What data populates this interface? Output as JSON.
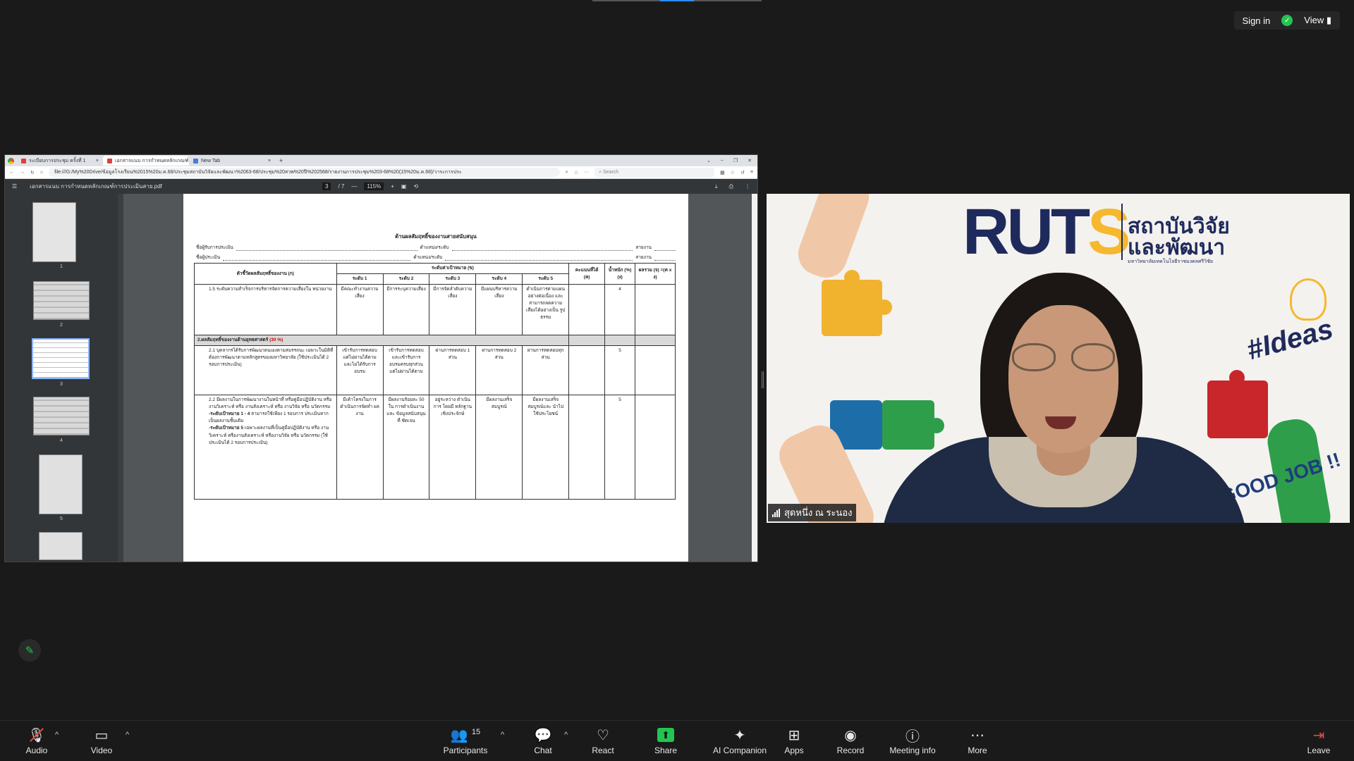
{
  "topbar": {
    "sign_in": "Sign in",
    "view": "View"
  },
  "browser": {
    "tabs": [
      {
        "label": "ระเบียบการประชุม ครั้งที่ 1",
        "active": false
      },
      {
        "label": "เอกสารแนบ การกำหนดหลักเกณฑ์",
        "active": true
      },
      {
        "label": "New Tab",
        "active": false
      }
    ],
    "url": "file:///G:/My%20Drive/ข้อมูลโรงเรียน%2015%20ม.ค.68/ประชุมสถาบันวิจัยและพัฒนา%2063-68/ประชุม%20สวพ%20ปี%202568/รายงานการประชุม%203-68%20(15%20ม.ค.68)/วาระการประ",
    "search_placeholder": "Search"
  },
  "pdf": {
    "title": "เอกสารแนบ การกำหนดหลักเกณฑ์การประเมินสาย.pdf",
    "page_current": "3",
    "page_total": "/ 7",
    "zoom": "115%",
    "thumb_numbers": [
      "1",
      "2",
      "3",
      "4",
      "5"
    ]
  },
  "document": {
    "heading": "ด้านผลสัมฤทธิ์ของงานสายสนับสนุน",
    "line1": {
      "label": "ชื่อผู้รับการประเมิน",
      "mid": "ตำแหน่ง/ระดับ",
      "end": "สายงาน"
    },
    "line2": {
      "label": "ชื่อผู้ประเมิน",
      "mid": "ตำแหน่ง/ระดับ",
      "end": "สายงาน"
    },
    "headers": {
      "indicator": "ตัวชี้วัดผลสัมฤทธิ์ของงาน (ก)",
      "target": "ระดับค่าเป้าหมาย (ข)",
      "levels": [
        "ระดับ 1",
        "ระดับ 2",
        "ระดับ 3",
        "ระดับ 4",
        "ระดับ 5"
      ],
      "score": "คะแนนที่ได้ (ค)",
      "weight": "น้ำหนัก (%) (ง)",
      "total": "ผลรวม (จ) =(ค x ง)"
    },
    "rows": [
      {
        "indicator": "1.5 ระดับความสำเร็จการบริหารจัดการความเสี่ยงใน หน่วยงาน",
        "levels": [
          "มีคณะทำงานความ เสี่ยง",
          "มีการระบุความเสี่ยง",
          "มีการจัดลำดับความ เสี่ยง",
          "มีแผนบริหารความ เสี่ยง",
          "ดำเนินการตามแผน อย่างต่อเนื่อง และ สามารถลดความ เสี่ยงได้อย่างเป็น รูปธรรม"
        ],
        "weight": "4"
      }
    ],
    "section2": {
      "label": "2.ผลสัมฤทธิ์ของงานด้านยุทธศาสตร์",
      "pct": "(30 %)"
    },
    "rows2": [
      {
        "indicator": "2.1 บุคลากรได้รับการพัฒนาตนเองตามสมรรถนะ เฉพาะในมิติที่ต้องการพัฒนาตามหลักสูตรของมหาวิทยาลัย (ใช้ประเมินได้ 2 รอบการประเมิน)",
        "levels": [
          "เข้ารับการทดสอบ แต่ไม่ผ่านได้ตาม และไม่ได้รับการ อบรม",
          "เข้ารับการทดสอบ และเข้ารับการ อบรมครบทุกส่วน แต่ไม่ผ่านได้ตาม",
          "ผ่านการทดสอบ 1 ส่วน",
          "ผ่านการทดสอบ 2 ส่วน",
          "ผ่านการทดสอบทุก ส่วน"
        ],
        "weight": "5"
      },
      {
        "indicator": "2.2 มีผลงานในการพัฒนางานในหน้าที่ หรือคู่มือปฏิบัติงาน หรืองานวิเคราะห์ หรือ งานสังเคราะห์ หรือ งานวิจัย หรือ นวัตกรรม",
        "note1_bold": "-ระดับเป้าหมาย 1 - 4",
        "note1": "สามารถใช้เพียง 1 รอบการ ประเมินหากเป็นผลงานชิ้นเดิม",
        "note2_bold": "-ระดับเป้าหมาย 5",
        "note2": "เฉพาะผลงานที่เป็นคู่มือปฏิบัติงาน หรือ งานวิเคราะห์ หรืองานสังเคราะห์ หรืองานวิจัย หรือ นวัตกรรม (ใช้ประเมินได้ 2 รอบการประเมิน)",
        "levels": [
          "มีเค้าโครงในการ ดำเนินการจัดทำ ผลงาน",
          "มีผลงานร้อยละ 50 ใน การดำเนินงาน และ ข้อมูลสนับสนุนที่ ชัดเจน",
          "อยู่ระหว่าง ดำเนินการ โดยมี หลักฐานเชิงประจักษ์",
          "มีผลงานเสร็จสมบูรณ์",
          "มีผลงานเสร็จ สมบูรณ์และ นำไปใช้ประโยชน์"
        ],
        "weight": "5"
      }
    ]
  },
  "video": {
    "brand": "RUTS",
    "brand_th_1": "สถาบันวิจัย",
    "brand_th_2": "และพัฒนา",
    "brand_sub": "มหาวิทยาลัยเทคโนโลยีราชมงคลศรีวิชัย",
    "ideas": "#Ideas",
    "goodjob": "GOOD JOB !!",
    "participant_name": "สุดหนึ่ง ณ ระนอง"
  },
  "toolbar": {
    "audio": "Audio",
    "video": "Video",
    "participants": "Participants",
    "participants_count": "15",
    "chat": "Chat",
    "react": "React",
    "share": "Share",
    "ai": "AI Companion",
    "apps": "Apps",
    "record": "Record",
    "meeting_info": "Meeting info",
    "more": "More",
    "leave": "Leave"
  }
}
